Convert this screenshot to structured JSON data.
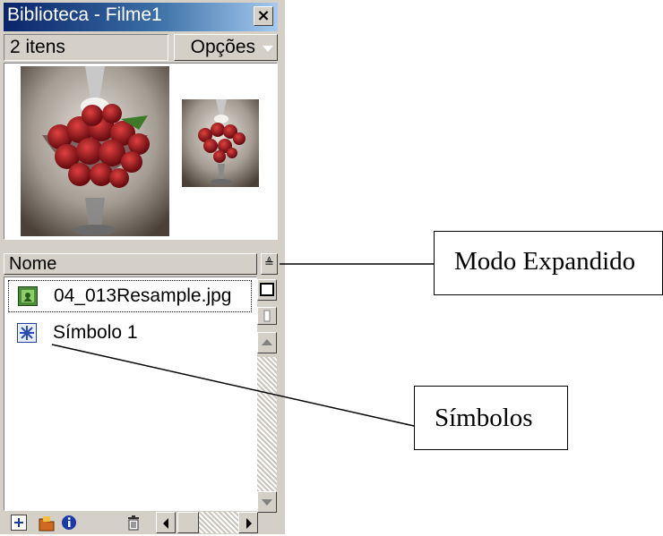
{
  "panel": {
    "title": "Biblioteca - Filme1",
    "close_label": "×",
    "item_count": "2 itens",
    "options_label": "Opções",
    "column_name": "Nome",
    "items": [
      {
        "label": "04_013Resample.jpg",
        "icon": "bitmap-icon",
        "selected": true
      },
      {
        "label": "Símbolo 1",
        "icon": "symbol-icon",
        "selected": false
      }
    ]
  },
  "callouts": {
    "expanded_mode": "Modo Expandido",
    "symbols": "Símbolos"
  },
  "colors": {
    "titlebar_start": "#0a246a",
    "titlebar_end": "#a6caf0",
    "panel_bg": "#d4d0c8"
  }
}
